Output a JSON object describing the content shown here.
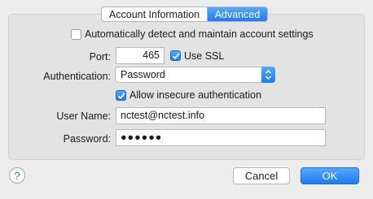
{
  "tabs": {
    "account_information": "Account Information",
    "advanced": "Advanced"
  },
  "auto_detect": {
    "label": "Automatically detect and maintain account settings",
    "checked": false
  },
  "port": {
    "label": "Port:",
    "value": "465"
  },
  "ssl": {
    "label": "Use SSL",
    "checked": true
  },
  "authentication": {
    "label": "Authentication:",
    "selected": "Password"
  },
  "insecure_auth": {
    "label": "Allow insecure authentication",
    "checked": true
  },
  "user_name": {
    "label": "User Name:",
    "value": "nctest@nctest.info"
  },
  "password": {
    "label": "Password:",
    "value": "●●●●●●"
  },
  "footer": {
    "help_icon": "?",
    "cancel_label": "Cancel",
    "ok_label": "OK"
  },
  "colors": {
    "accent": "#1b7cf2",
    "window_background": "#ececec",
    "panel_background": "#e3e3e3"
  },
  "icons": {
    "checkbox_checked": "checkmark-icon",
    "select_indicator": "up-down-chevron-icon",
    "help": "question-mark-icon"
  }
}
